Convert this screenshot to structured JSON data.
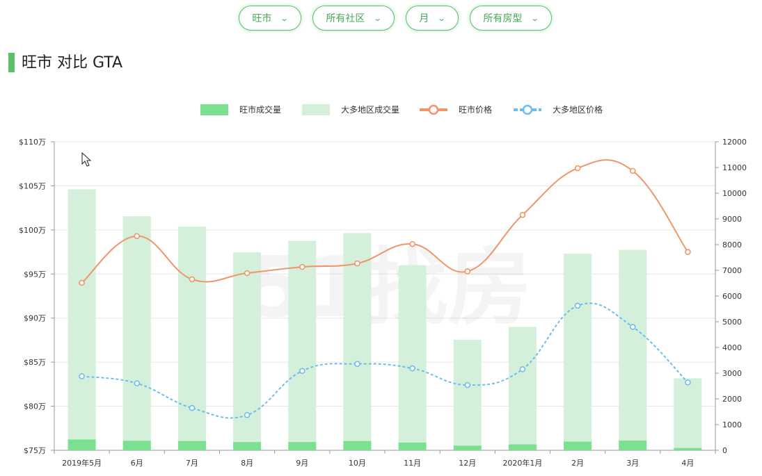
{
  "filters": [
    {
      "label": "旺市",
      "name": "filter-city"
    },
    {
      "label": "所有社区",
      "name": "filter-community"
    },
    {
      "label": "月",
      "name": "filter-period"
    },
    {
      "label": "所有房型",
      "name": "filter-house-type"
    }
  ],
  "page_title": "旺市 对比 GTA",
  "colors": {
    "accent": "#5cbf6a",
    "local_bar": "#7be08f",
    "gta_bar": "#d4f0da",
    "local_line": "#f0956a",
    "gta_line": "#6cbcf0"
  },
  "chart_data": {
    "type": "bar+line",
    "categories": [
      "2019年5月",
      "6月",
      "7月",
      "8月",
      "9月",
      "10月",
      "11月",
      "12月",
      "2020年1月",
      "2月",
      "3月",
      "4月"
    ],
    "legend": [
      "旺市成交量",
      "大多地区成交量",
      "旺市价格",
      "大多地区价格"
    ],
    "legend_position": "top-center",
    "y_left": {
      "min": 75,
      "max": 110,
      "step": 5,
      "tick_prefix": "$",
      "tick_suffix": "万"
    },
    "y_right": {
      "min": 0,
      "max": 12000,
      "step": 1000
    },
    "series": [
      {
        "name": "旺市成交量",
        "type": "bar",
        "axis": "right",
        "values": [
          420,
          370,
          360,
          320,
          320,
          360,
          300,
          180,
          230,
          340,
          380,
          90
        ]
      },
      {
        "name": "大多地区成交量",
        "type": "bar",
        "axis": "right",
        "values": [
          10150,
          9100,
          8700,
          7700,
          8150,
          8450,
          7200,
          4300,
          4800,
          7650,
          7800,
          2800
        ]
      },
      {
        "name": "旺市价格",
        "type": "line",
        "axis": "left",
        "values": [
          94.0,
          99.3,
          94.4,
          95.1,
          95.8,
          96.2,
          98.4,
          95.3,
          101.7,
          107.0,
          106.7,
          97.5
        ]
      },
      {
        "name": "大多地区价格",
        "type": "line",
        "axis": "left",
        "dashed": true,
        "values": [
          83.4,
          82.6,
          79.8,
          79.0,
          84.0,
          84.8,
          84.3,
          82.4,
          84.2,
          91.4,
          89.0,
          82.7
        ]
      }
    ],
    "grid": true
  }
}
